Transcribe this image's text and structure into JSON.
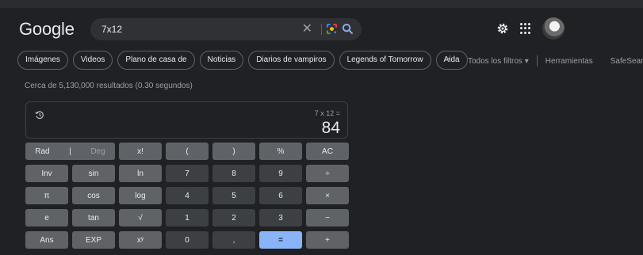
{
  "header": {
    "logo": "Google",
    "search_query": "7x12",
    "clear_symbol": "✕"
  },
  "chips": [
    "Imágenes",
    "Videos",
    "Plano de casa de",
    "Noticias",
    "Diarios de vampiros",
    "Legends of Tomorrow",
    "Aida"
  ],
  "tools": {
    "chevron": ">",
    "filters": "Todos los filtros ▾",
    "tools": "Herramientas",
    "safesearch": "SafeSearch"
  },
  "results_info": "Cerca de 5,130,000 resultados (0.30 segundos)",
  "calculator": {
    "expression": "7 x 12 =",
    "result": "84",
    "rad": "Rad",
    "separator": "|",
    "deg": "Deg",
    "keys": {
      "fact": "x!",
      "lparen": "(",
      "rparen": ")",
      "percent": "%",
      "ac": "AC",
      "inv": "Inv",
      "sin": "sin",
      "ln": "ln",
      "k7": "7",
      "k8": "8",
      "k9": "9",
      "div": "÷",
      "pi": "π",
      "cos": "cos",
      "log": "log",
      "k4": "4",
      "k5": "5",
      "k6": "6",
      "mul": "×",
      "e": "e",
      "tan": "tan",
      "sqrt": "√",
      "k1": "1",
      "k2": "2",
      "k3": "3",
      "sub": "−",
      "ans": "Ans",
      "exp": "EXP",
      "pow": "xʸ",
      "k0": "0",
      "dot": ",",
      "eq": "=",
      "add": "+"
    }
  },
  "colors": {
    "background": "#202124",
    "accent": "#8ab4f8",
    "key_fn": "#5f6368",
    "key_num": "#3c4043"
  },
  "icons": [
    "google-lens-icon",
    "search-icon",
    "settings-gear-icon",
    "apps-grid-icon",
    "history-icon"
  ]
}
